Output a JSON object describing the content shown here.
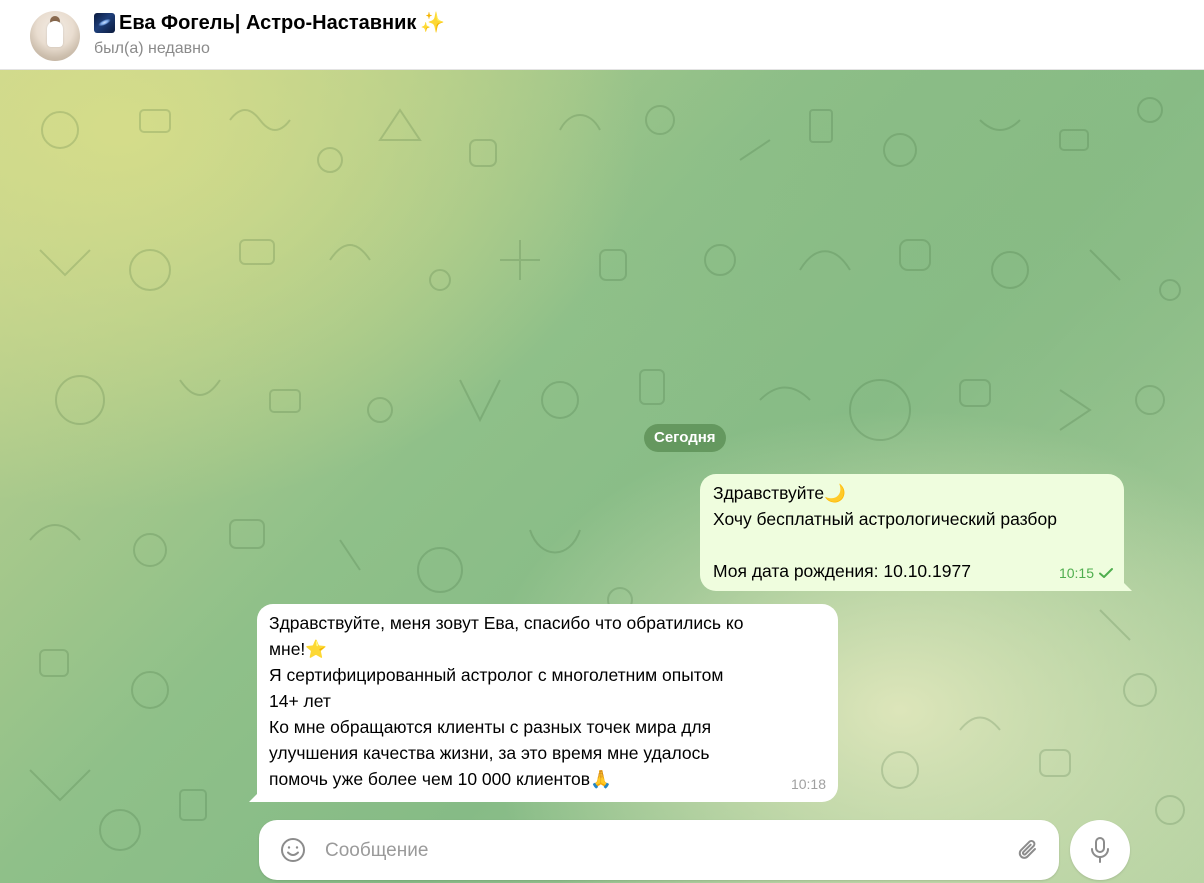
{
  "header": {
    "title": "Ева Фогель| Астро-Наставник",
    "status": "был(а) недавно",
    "title_icon_left": "galaxy-icon",
    "title_icon_right": "sparkle-icon"
  },
  "chat": {
    "date_separator": "Сегодня",
    "messages": [
      {
        "direction": "outgoing",
        "lines": [
          "Здравствуйте",
          "Хочу бесплатный астрологический разбор",
          "",
          "Моя дата рождения: 10.10.1977"
        ],
        "emoji": "🌙",
        "time": "10:15",
        "status_icon": "check-icon"
      },
      {
        "direction": "incoming",
        "lines": [
          "Здравствуйте, меня зовут Ева, спасибо что обратились ко",
          "мне!",
          "Я сертифицированный астролог с многолетним опытом",
          "14+ лет",
          "Ко мне обращаются клиенты с разных точек мира для",
          "улучшения качества жизни, за это время мне удалось",
          "помочь уже более чем 10 000 клиентов"
        ],
        "emoji_star": "⭐",
        "emoji_pray": "🙏",
        "time": "10:18"
      }
    ]
  },
  "composer": {
    "placeholder": "Сообщение",
    "value": ""
  },
  "colors": {
    "outgoing_bubble": "#effdde",
    "incoming_bubble": "#ffffff",
    "time_outgoing": "#4fae4e",
    "date_pill": "#588c52"
  }
}
